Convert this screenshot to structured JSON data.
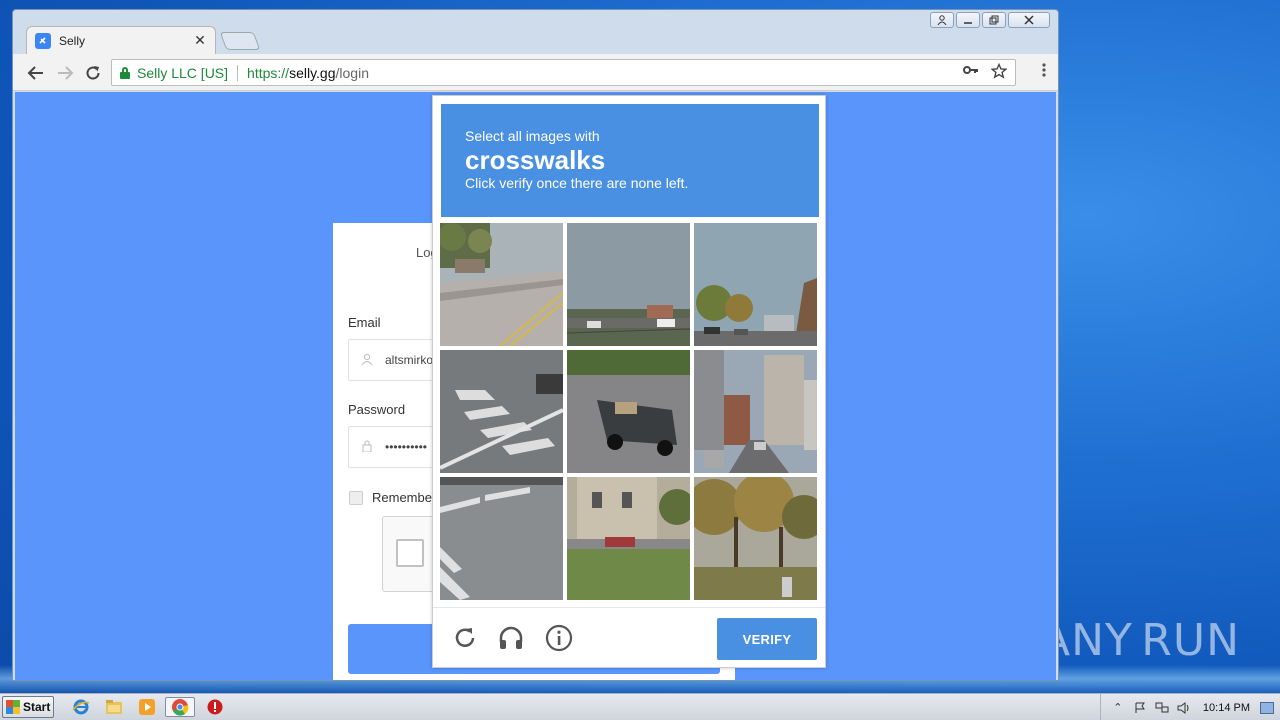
{
  "browser": {
    "tab_title": "Selly",
    "ev_name": "Selly LLC [US]",
    "url_scheme": "https://",
    "url_host": "selly.gg",
    "url_path": "/login"
  },
  "page": {
    "card_title": "Log",
    "email_label": "Email",
    "email_value": "altsmirko",
    "password_label": "Password",
    "password_value": "••••••••••",
    "remember_label": "Remember"
  },
  "captcha": {
    "instruction_pre": "Select all images with",
    "keyword": "crosswalks",
    "instruction_post": "Click verify once there are none left.",
    "verify_label": "VERIFY",
    "tiles": [
      {
        "name": "road-with-yellow-lines"
      },
      {
        "name": "parking-lot-sky"
      },
      {
        "name": "trees-and-building"
      },
      {
        "name": "crosswalk-stripes"
      },
      {
        "name": "pickup-truck-road"
      },
      {
        "name": "city-street-buildings"
      },
      {
        "name": "crosswalk-corner"
      },
      {
        "name": "house-with-lawn"
      },
      {
        "name": "park-trees"
      }
    ]
  },
  "watermark": {
    "left": "ANY",
    "right": "RUN"
  },
  "taskbar": {
    "start_label": "Start",
    "clock": "10:14 PM"
  },
  "colors": {
    "page_bg": "#5a95fb",
    "captcha_blue": "#4a90e2",
    "secure_green": "#1e8a3a"
  }
}
